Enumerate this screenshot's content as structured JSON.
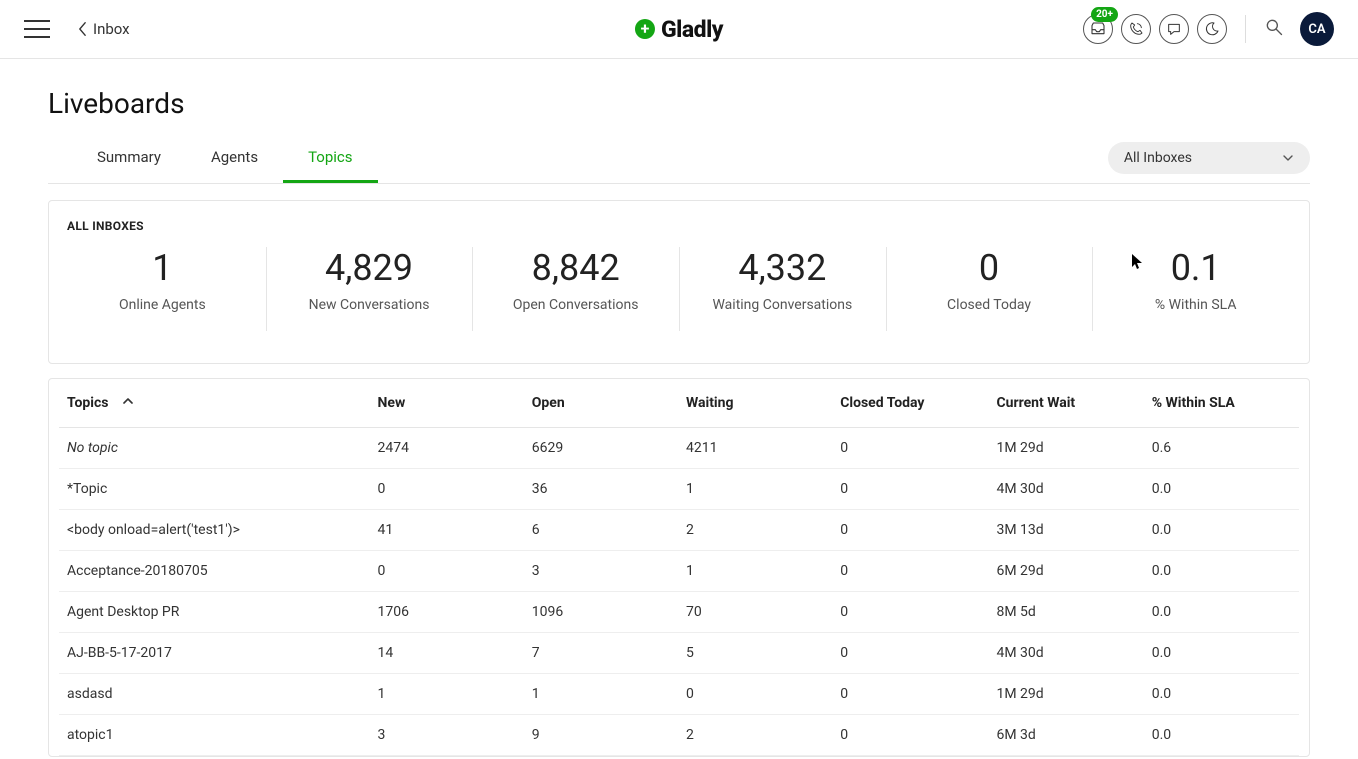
{
  "header": {
    "inbox_label": "Inbox",
    "brand_name": "Gladly",
    "badge": "20+",
    "avatar_initials": "CA"
  },
  "page": {
    "title": "Liveboards"
  },
  "tabs": [
    {
      "label": "Summary",
      "active": false
    },
    {
      "label": "Agents",
      "active": false
    },
    {
      "label": "Topics",
      "active": true
    }
  ],
  "filter": {
    "selected": "All Inboxes"
  },
  "stats_panel": {
    "title": "ALL INBOXES",
    "cells": [
      {
        "value": "1",
        "label": "Online Agents"
      },
      {
        "value": "4,829",
        "label": "New Conversations"
      },
      {
        "value": "8,842",
        "label": "Open Conversations"
      },
      {
        "value": "4,332",
        "label": "Waiting Conversations"
      },
      {
        "value": "0",
        "label": "Closed Today"
      },
      {
        "value": "0.1",
        "label": "% Within SLA"
      }
    ]
  },
  "table": {
    "columns": [
      "Topics",
      "New",
      "Open",
      "Waiting",
      "Closed Today",
      "Current Wait",
      "% Within SLA"
    ],
    "sort_column": "Topics",
    "sort_dir": "asc",
    "rows": [
      {
        "topic": "No topic",
        "italic": true,
        "new": "2474",
        "open": "6629",
        "waiting": "4211",
        "closed": "0",
        "wait": "1M 29d",
        "sla": "0.6"
      },
      {
        "topic": "*Topic",
        "italic": false,
        "new": "0",
        "open": "36",
        "waiting": "1",
        "closed": "0",
        "wait": "4M 30d",
        "sla": "0.0"
      },
      {
        "topic": "<body onload=alert('test1')>",
        "italic": false,
        "new": "41",
        "open": "6",
        "waiting": "2",
        "closed": "0",
        "wait": "3M 13d",
        "sla": "0.0"
      },
      {
        "topic": "Acceptance-20180705",
        "italic": false,
        "new": "0",
        "open": "3",
        "waiting": "1",
        "closed": "0",
        "wait": "6M 29d",
        "sla": "0.0"
      },
      {
        "topic": "Agent Desktop PR",
        "italic": false,
        "new": "1706",
        "open": "1096",
        "waiting": "70",
        "closed": "0",
        "wait": "8M 5d",
        "sla": "0.0"
      },
      {
        "topic": "AJ-BB-5-17-2017",
        "italic": false,
        "new": "14",
        "open": "7",
        "waiting": "5",
        "closed": "0",
        "wait": "4M 30d",
        "sla": "0.0"
      },
      {
        "topic": "asdasd",
        "italic": false,
        "new": "1",
        "open": "1",
        "waiting": "0",
        "closed": "0",
        "wait": "1M 29d",
        "sla": "0.0"
      },
      {
        "topic": "atopic1",
        "italic": false,
        "new": "3",
        "open": "9",
        "waiting": "2",
        "closed": "0",
        "wait": "6M 3d",
        "sla": "0.0"
      }
    ]
  }
}
